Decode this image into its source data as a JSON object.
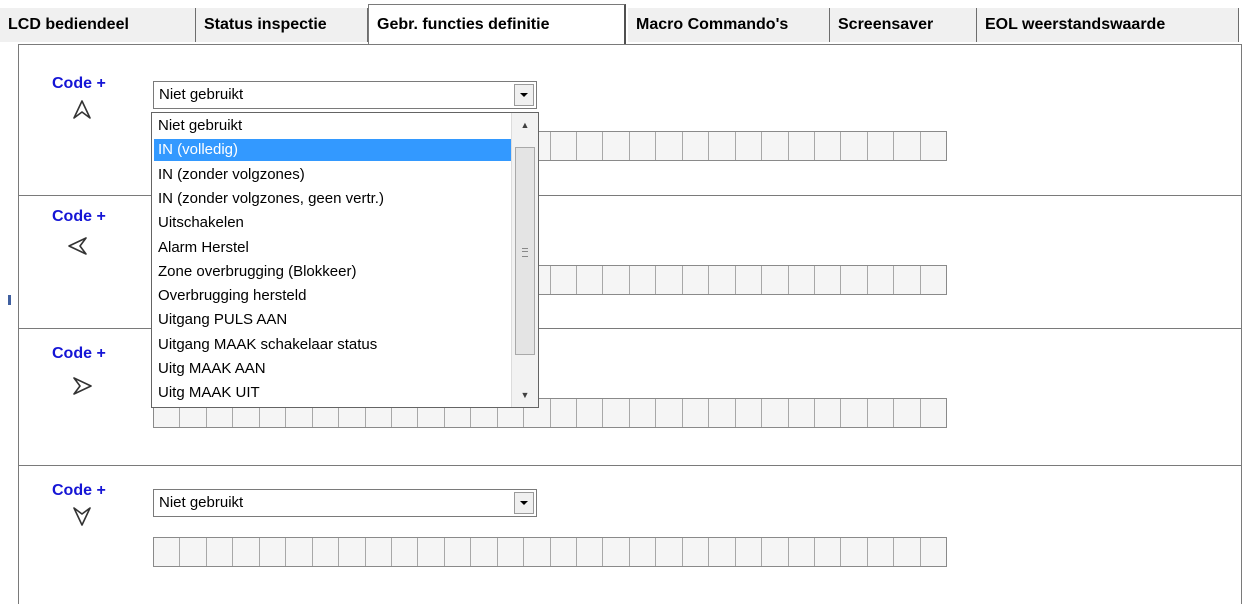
{
  "tabs": [
    {
      "label": "LCD bediendeel",
      "active": false
    },
    {
      "label": "Status inspectie",
      "active": false
    },
    {
      "label": "Gebr. functies definitie",
      "active": true
    },
    {
      "label": "Macro Commando's",
      "active": false
    },
    {
      "label": "Screensaver",
      "active": false
    },
    {
      "label": "EOL weerstandswaarde",
      "active": false
    }
  ],
  "sections": [
    {
      "code_label": "Code +",
      "arrow_icon": "arrow-up-icon",
      "combo_value": "Niet gebruikt"
    },
    {
      "code_label": "Code +",
      "arrow_icon": "arrow-left-icon",
      "combo_value": ""
    },
    {
      "code_label": "Code +",
      "arrow_icon": "arrow-right-icon",
      "combo_value": ""
    },
    {
      "code_label": "Code +",
      "arrow_icon": "arrow-down-icon",
      "combo_value": "Niet gebruikt"
    }
  ],
  "dropdown": {
    "items": [
      "Niet gebruikt",
      "IN (volledig)",
      "IN (zonder volgzones)",
      "IN (zonder volgzones, geen vertr.)",
      "Uitschakelen",
      "Alarm Herstel",
      "Zone overbrugging (Blokkeer)",
      "Overbrugging hersteld",
      "Uitgang PULS AAN",
      "Uitgang MAAK schakelaar status",
      "Uitg MAAK AAN",
      "Uitg MAAK UIT"
    ],
    "selected_index": 1
  },
  "colors": {
    "code_label": "#1515d5",
    "selection": "#3399ff"
  }
}
